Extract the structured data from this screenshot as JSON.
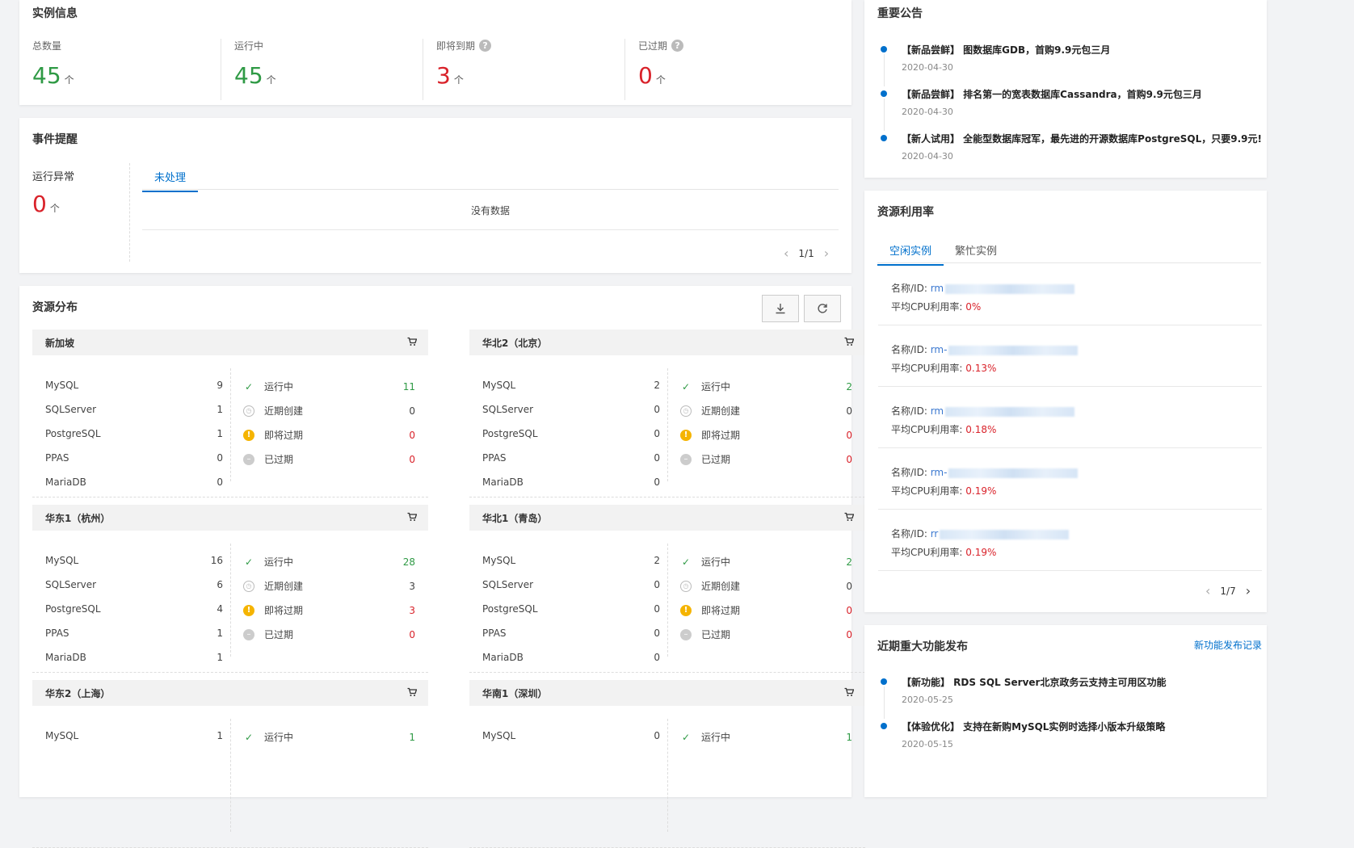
{
  "instance_info": {
    "title": "实例信息",
    "stats": [
      {
        "label": "总数量",
        "value": "45",
        "unit": "个",
        "color": "green",
        "help": false
      },
      {
        "label": "运行中",
        "value": "45",
        "unit": "个",
        "color": "green",
        "help": false
      },
      {
        "label": "即将到期",
        "value": "3",
        "unit": "个",
        "color": "red",
        "help": true
      },
      {
        "label": "已过期",
        "value": "0",
        "unit": "个",
        "color": "red",
        "help": true
      }
    ]
  },
  "events": {
    "title": "事件提醒",
    "abnormal_label": "运行异常",
    "abnormal_value": "0",
    "abnormal_unit": "个",
    "tab": "未处理",
    "empty_text": "没有数据",
    "page": "1/1"
  },
  "distribution": {
    "title": "资源分布",
    "regions": [
      {
        "name": "新加坡",
        "dbs": [
          [
            "MySQL",
            "9"
          ],
          [
            "SQLServer",
            "1"
          ],
          [
            "PostgreSQL",
            "1"
          ],
          [
            "PPAS",
            "0"
          ],
          [
            "MariaDB",
            "0"
          ]
        ],
        "status": [
          [
            "运行中",
            "11"
          ],
          [
            "近期创建",
            "0"
          ],
          [
            "即将过期",
            "0"
          ],
          [
            "已过期",
            "0"
          ]
        ]
      },
      {
        "name": "华北2（北京）",
        "dbs": [
          [
            "MySQL",
            "2"
          ],
          [
            "SQLServer",
            "0"
          ],
          [
            "PostgreSQL",
            "0"
          ],
          [
            "PPAS",
            "0"
          ],
          [
            "MariaDB",
            "0"
          ]
        ],
        "status": [
          [
            "运行中",
            "2"
          ],
          [
            "近期创建",
            "0"
          ],
          [
            "即将过期",
            "0"
          ],
          [
            "已过期",
            "0"
          ]
        ]
      },
      {
        "name": "华东1（杭州）",
        "dbs": [
          [
            "MySQL",
            "16"
          ],
          [
            "SQLServer",
            "6"
          ],
          [
            "PostgreSQL",
            "4"
          ],
          [
            "PPAS",
            "1"
          ],
          [
            "MariaDB",
            "1"
          ]
        ],
        "status": [
          [
            "运行中",
            "28"
          ],
          [
            "近期创建",
            "3"
          ],
          [
            "即将过期",
            "3"
          ],
          [
            "已过期",
            "0"
          ]
        ]
      },
      {
        "name": "华北1（青岛）",
        "dbs": [
          [
            "MySQL",
            "2"
          ],
          [
            "SQLServer",
            "0"
          ],
          [
            "PostgreSQL",
            "0"
          ],
          [
            "PPAS",
            "0"
          ],
          [
            "MariaDB",
            "0"
          ]
        ],
        "status": [
          [
            "运行中",
            "2"
          ],
          [
            "近期创建",
            "0"
          ],
          [
            "即将过期",
            "0"
          ],
          [
            "已过期",
            "0"
          ]
        ]
      },
      {
        "name": "华东2（上海）",
        "dbs": [
          [
            "MySQL",
            "1"
          ]
        ],
        "status": [
          [
            "运行中",
            "1"
          ]
        ]
      },
      {
        "name": "华南1（深圳）",
        "dbs": [
          [
            "MySQL",
            "0"
          ]
        ],
        "status": [
          [
            "运行中",
            "1"
          ]
        ]
      }
    ]
  },
  "announcements": {
    "title": "重要公告",
    "items": [
      {
        "title": "【新品尝鲜】 图数据库GDB，首购9.9元包三月",
        "date": "2020-04-30"
      },
      {
        "title": "【新品尝鲜】 排名第一的宽表数据库Cassandra，首购9.9元包三月",
        "date": "2020-04-30"
      },
      {
        "title": "【新人试用】 全能型数据库冠军，最先进的开源数据库PostgreSQL，只要9.9元!",
        "date": "2020-04-30"
      }
    ]
  },
  "utilization": {
    "title": "资源利用率",
    "tabs": [
      "空闲实例",
      "繁忙实例"
    ],
    "name_label": "名称/ID:",
    "cpu_label": "平均CPU利用率:",
    "items": [
      {
        "id_prefix": "rm",
        "cpu": "0%"
      },
      {
        "id_prefix": "rm-",
        "cpu": "0.13%"
      },
      {
        "id_prefix": "rm",
        "cpu": "0.18%"
      },
      {
        "id_prefix": "rm-",
        "cpu": "0.19%"
      },
      {
        "id_prefix": "rr",
        "cpu": "0.19%"
      }
    ],
    "page": "1/7"
  },
  "releases": {
    "title": "近期重大功能发布",
    "link": "新功能发布记录",
    "items": [
      {
        "title": "【新功能】 RDS SQL Server北京政务云支持主可用区功能",
        "date": "2020-05-25"
      },
      {
        "title": "【体验优化】 支持在新购MySQL实例时选择小版本升级策略",
        "date": "2020-05-15"
      }
    ]
  }
}
